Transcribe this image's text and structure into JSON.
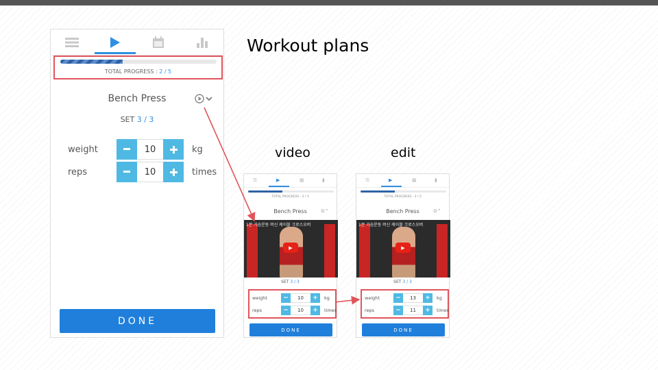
{
  "slide": {
    "title": "Workout plans",
    "caption_video": "video",
    "caption_edit": "edit"
  },
  "colors": {
    "accent": "#2f8fe3",
    "stepper": "#4fb9e3",
    "done": "#1f7fdb",
    "highlight": "#e0555a"
  },
  "main": {
    "tabs": [
      {
        "icon": "list-icon"
      },
      {
        "icon": "play-icon"
      },
      {
        "icon": "calendar-icon"
      },
      {
        "icon": "bar-chart-icon"
      }
    ],
    "active_tab": 1,
    "progress": {
      "label": "TOTAL PROGRESS :",
      "value": "2 / 5",
      "fraction": 0.4
    },
    "exercise": {
      "name": "Bench Press"
    },
    "set": {
      "label": "SET",
      "value": "3 / 3"
    },
    "weight": {
      "label": "weight",
      "value": "10",
      "unit": "kg"
    },
    "reps": {
      "label": "reps",
      "value": "10",
      "unit": "times"
    },
    "done_label": "DONE"
  },
  "video_view": {
    "progress_text": "TOTAL PROGRESS : 2 / 5",
    "exercise_name": "Bench Press",
    "video_title": "1분 가슴운동 머신 케이블 크로스오버",
    "set_label": "SET",
    "set_value": "3 / 3",
    "weight": {
      "label": "weight",
      "value": "10",
      "unit": "kg"
    },
    "reps": {
      "label": "reps",
      "value": "10",
      "unit": "times"
    },
    "done_label": "DONE"
  },
  "edit_view": {
    "progress_text": "TOTAL PROGRESS : 2 / 5",
    "exercise_name": "Bench Press",
    "video_title": "1분 가슴운동 머신 케이블 크로스오버",
    "set_label": "SET",
    "set_value": "3 / 3",
    "weight": {
      "label": "weight",
      "value": "13",
      "unit": "kg"
    },
    "reps": {
      "label": "reps",
      "value": "11",
      "unit": "times"
    },
    "done_label": "DONE"
  }
}
